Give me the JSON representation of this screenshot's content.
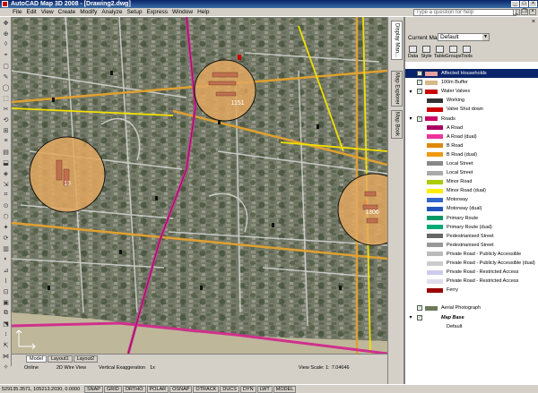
{
  "window": {
    "title": "AutoCAD Map 3D 2008 - [Drawing2.dwg]"
  },
  "menu": {
    "items": [
      "File",
      "Edit",
      "View",
      "Create",
      "Modify",
      "Analyze",
      "Setup",
      "Express",
      "Window",
      "Help"
    ],
    "help_placeholder": "Type a question for help"
  },
  "left_tools": [
    "✥",
    "⊕",
    "◊",
    "⌖",
    "▢",
    "✎",
    "◯",
    "⬚",
    "✂",
    "⟲",
    "⊞",
    "≡",
    "▤",
    "⬓",
    "◈",
    "⇲",
    "⌗",
    "⊙",
    "⬡",
    "✦",
    "⟳",
    "▥",
    "◐",
    "⊿",
    "⌇",
    "⊡",
    "▣",
    "⧉",
    "⬔",
    "↕",
    "⇱",
    "⋈",
    "✧"
  ],
  "map": {
    "buffers": [
      {
        "label": "13"
      },
      {
        "label": "1151"
      },
      {
        "label": "1306"
      }
    ]
  },
  "vtabs": [
    "Display Man...",
    "Map Explorer",
    "Map Book"
  ],
  "panel": {
    "current_map_label": "Current Map:",
    "current_map_value": "Default",
    "tools": [
      "Data",
      "Style",
      "Table",
      "Groups",
      "Tools"
    ],
    "layers": [
      {
        "label": "Affected Households",
        "indent": 0,
        "exp": "",
        "checked": true,
        "swatch": "#e8a0a0",
        "selected": true
      },
      {
        "label": "100m Buffer",
        "indent": 0,
        "exp": "",
        "checked": true,
        "swatch": "#d8b888",
        "selected": false
      },
      {
        "label": "Water Valves",
        "indent": 0,
        "exp": "▾",
        "checked": true,
        "swatch": "#cc0000",
        "selected": false
      },
      {
        "label": "Working",
        "indent": 1,
        "exp": "",
        "checked": false,
        "swatch": "#333333",
        "selected": false
      },
      {
        "label": "Valve Shut down",
        "indent": 1,
        "exp": "",
        "checked": false,
        "swatch": "#cc0000",
        "selected": false
      },
      {
        "label": "Roads",
        "indent": 0,
        "exp": "▾",
        "checked": true,
        "swatch": "#cc0066",
        "selected": false
      },
      {
        "label": "A Road",
        "indent": 1,
        "exp": "",
        "checked": false,
        "swatch": "#aa0066",
        "selected": false
      },
      {
        "label": "A Road (dual)",
        "indent": 1,
        "exp": "",
        "checked": false,
        "swatch": "#ee3399",
        "selected": false
      },
      {
        "label": "B Road",
        "indent": 1,
        "exp": "",
        "checked": false,
        "swatch": "#dd8800",
        "selected": false
      },
      {
        "label": "B Road (dual)",
        "indent": 1,
        "exp": "",
        "checked": false,
        "swatch": "#ee9911",
        "selected": false
      },
      {
        "label": "Local Street",
        "indent": 1,
        "exp": "",
        "checked": false,
        "swatch": "#888888",
        "selected": false
      },
      {
        "label": "Local Street",
        "indent": 1,
        "exp": "",
        "checked": false,
        "swatch": "#aaaaaa",
        "selected": false
      },
      {
        "label": "Minor Road",
        "indent": 1,
        "exp": "",
        "checked": false,
        "swatch": "#aacc00",
        "selected": false
      },
      {
        "label": "Minor Road (dual)",
        "indent": 1,
        "exp": "",
        "checked": false,
        "swatch": "#ffee00",
        "selected": false
      },
      {
        "label": "Motorway",
        "indent": 1,
        "exp": "",
        "checked": false,
        "swatch": "#3366cc",
        "selected": false
      },
      {
        "label": "Motorway (dual)",
        "indent": 1,
        "exp": "",
        "checked": false,
        "swatch": "#2255bb",
        "selected": false
      },
      {
        "label": "Primary Route",
        "indent": 1,
        "exp": "",
        "checked": false,
        "swatch": "#009966",
        "selected": false
      },
      {
        "label": "Primary Route (dual)",
        "indent": 1,
        "exp": "",
        "checked": false,
        "swatch": "#00aa77",
        "selected": false
      },
      {
        "label": "Pedestrianised Street",
        "indent": 1,
        "exp": "",
        "checked": false,
        "swatch": "#666666",
        "selected": false
      },
      {
        "label": "Pedestrianised Street",
        "indent": 1,
        "exp": "",
        "checked": false,
        "swatch": "#999999",
        "selected": false
      },
      {
        "label": "Private Road - Publicly Accessible",
        "indent": 1,
        "exp": "",
        "checked": false,
        "swatch": "#bbbbbb",
        "selected": false
      },
      {
        "label": "Private Road - Publicly Accessible (dual)",
        "indent": 1,
        "exp": "",
        "checked": false,
        "swatch": "#cccccc",
        "selected": false
      },
      {
        "label": "Private Road - Restricted Access",
        "indent": 1,
        "exp": "",
        "checked": false,
        "swatch": "#ccccee",
        "selected": false
      },
      {
        "label": "Private Road - Restricted Access",
        "indent": 1,
        "exp": "",
        "checked": false,
        "swatch": "#ddddee",
        "selected": false
      },
      {
        "label": "Ferry",
        "indent": 1,
        "exp": "",
        "checked": false,
        "swatch": "#990000",
        "selected": false
      },
      {
        "label": "",
        "indent": 0,
        "exp": "",
        "checked": false,
        "swatch": "",
        "selected": false
      },
      {
        "label": "Aerial Photograph",
        "indent": 0,
        "exp": "",
        "checked": true,
        "swatch": "#6b7a5a",
        "selected": false
      },
      {
        "label": "Map Base",
        "indent": 0,
        "exp": "▾",
        "checked": true,
        "swatch": "",
        "selected": false
      },
      {
        "label": "Default",
        "indent": 1,
        "exp": "",
        "checked": false,
        "swatch": "",
        "selected": false
      }
    ]
  },
  "layout_tabs": [
    "Model",
    "Layout1",
    "Layout2"
  ],
  "status_row": {
    "online": "Online",
    "view_mode": "2D Wire View",
    "vertical_exaggeration_label": "Vertical Exaggeration",
    "vertical_exaggeration_value": "1x",
    "view_scale_label": "View Scale: 1:",
    "view_scale_value": "7.04646"
  },
  "statusbar": {
    "coords": "529135.3571, 105213.2030, 0.0000",
    "buttons": [
      "SNAP",
      "GRID",
      "ORTHO",
      "POLAR",
      "OSNAP",
      "OTRACK",
      "DUCS",
      "DYN",
      "LWT",
      "MODEL"
    ]
  }
}
